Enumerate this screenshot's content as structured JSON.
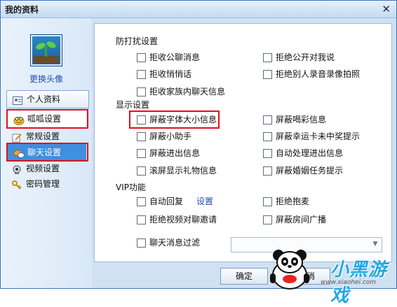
{
  "window": {
    "title": "我的资料",
    "close_glyph": "✕"
  },
  "sidebar": {
    "change_avatar": "更换头像",
    "items": [
      {
        "label": "个人资料",
        "icon": "contact-card-icon"
      },
      {
        "label": "呱呱设置",
        "icon": "frog-face-icon"
      },
      {
        "label": "常规设置",
        "icon": "edit-note-icon"
      },
      {
        "label": "聊天设置",
        "icon": "chat-bubbles-icon"
      },
      {
        "label": "视频设置",
        "icon": "webcam-icon"
      },
      {
        "label": "密码管理",
        "icon": "key-icon"
      }
    ]
  },
  "sections": {
    "anti_disturb": {
      "title": "防打扰设置",
      "options": [
        {
          "label": "拒收公聊消息",
          "checked": false
        },
        {
          "label": "拒绝公开对我说",
          "checked": false
        },
        {
          "label": "拒收悄悄话",
          "checked": false
        },
        {
          "label": "拒绝别人录音录像拍照",
          "checked": false
        },
        {
          "label": "拒收家族内聊天信息",
          "checked": false
        }
      ]
    },
    "display": {
      "title": "显示设置",
      "options": [
        {
          "label": "屏蔽字体大小信息",
          "checked": false
        },
        {
          "label": "屏蔽喝彩信息",
          "checked": false
        },
        {
          "label": "屏蔽小助手",
          "checked": false
        },
        {
          "label": "屏蔽幸运卡未中奖提示",
          "checked": false
        },
        {
          "label": "屏蔽进出信息",
          "checked": false
        },
        {
          "label": "自动处理进出信息",
          "checked": false
        },
        {
          "label": "滚屏显示礼物信息",
          "checked": false
        },
        {
          "label": "屏蔽婚姻任务提示",
          "checked": false
        }
      ]
    },
    "vip": {
      "title": "VIP功能",
      "auto_reply": "自动回复",
      "settings_link": "设置",
      "options": [
        {
          "label": "拒绝抱麦",
          "checked": false
        },
        {
          "label": "拒绝视频对聊邀请",
          "checked": false
        },
        {
          "label": "屏蔽房间广播",
          "checked": false
        },
        {
          "label": "聊天消息过滤",
          "checked": false
        }
      ],
      "filter_select_value": ""
    }
  },
  "footer": {
    "ok": "确定",
    "cancel": "取消"
  },
  "watermark": {
    "brand": "小黑游戏",
    "url": "www.xiaohei.com"
  },
  "colors": {
    "highlight_red": "#e0101d",
    "accent_blue": "#1c4fb4",
    "selected_bg": "#3d8fe0"
  }
}
